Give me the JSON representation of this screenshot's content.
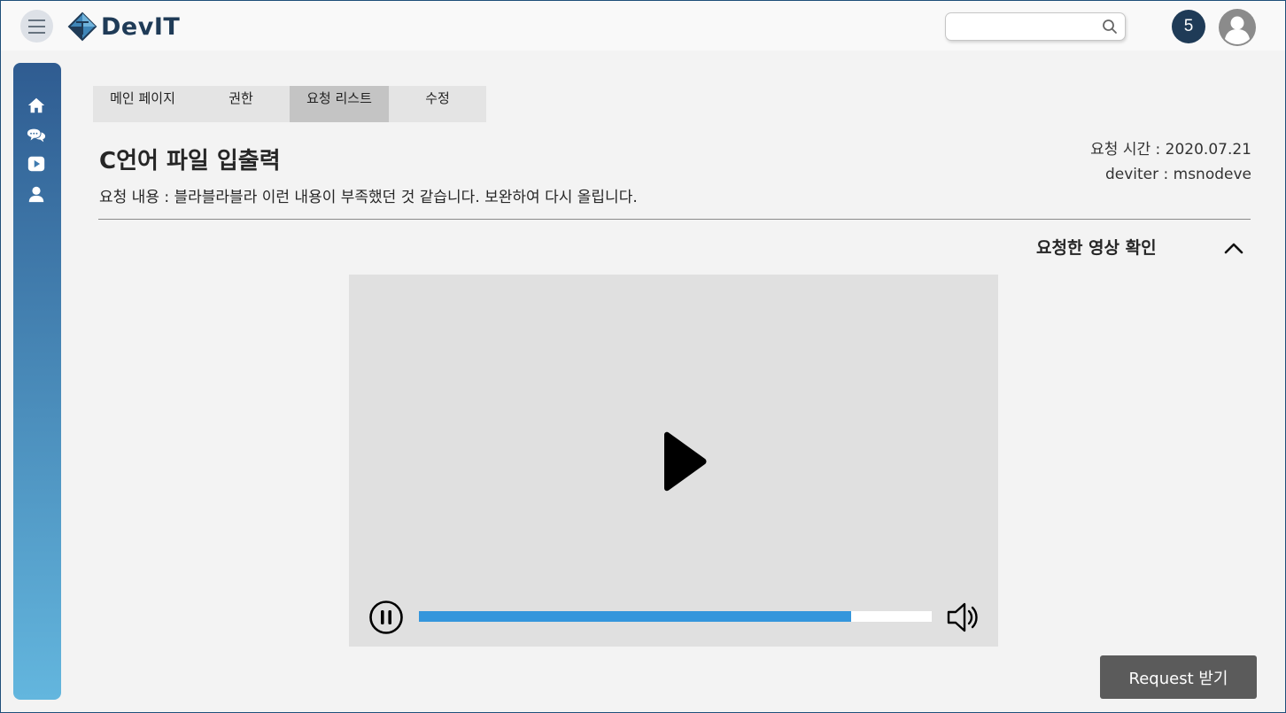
{
  "app": {
    "logo_text": "DevIT"
  },
  "header": {
    "search_placeholder": "",
    "notification_count": "5"
  },
  "sidebar": {
    "items": [
      {
        "icon": "home-icon"
      },
      {
        "icon": "chat-icon"
      },
      {
        "icon": "video-icon"
      },
      {
        "icon": "user-icon"
      }
    ]
  },
  "tabs": [
    {
      "label": "메인 페이지",
      "active": false
    },
    {
      "label": "권한",
      "active": false
    },
    {
      "label": "요청 리스트",
      "active": true
    },
    {
      "label": "수정",
      "active": false
    }
  ],
  "request": {
    "title": "C언어 파일 입출력",
    "description": "요청 내용 : 블라블라블라 이런 내용이 부족했던 것 같습니다. 보완하여 다시 올립니다.",
    "time": "요청 시간 : 2020.07.21",
    "user": "deviter : msnodeve"
  },
  "video_section": {
    "title": "요청한 영상 확인",
    "progress_fraction": 0.843
  },
  "actions": {
    "request_button": "Request 받기"
  },
  "colors": {
    "brand_dark": "#1f3b57",
    "progress": "#3496dc",
    "button": "#5b5b5b"
  }
}
